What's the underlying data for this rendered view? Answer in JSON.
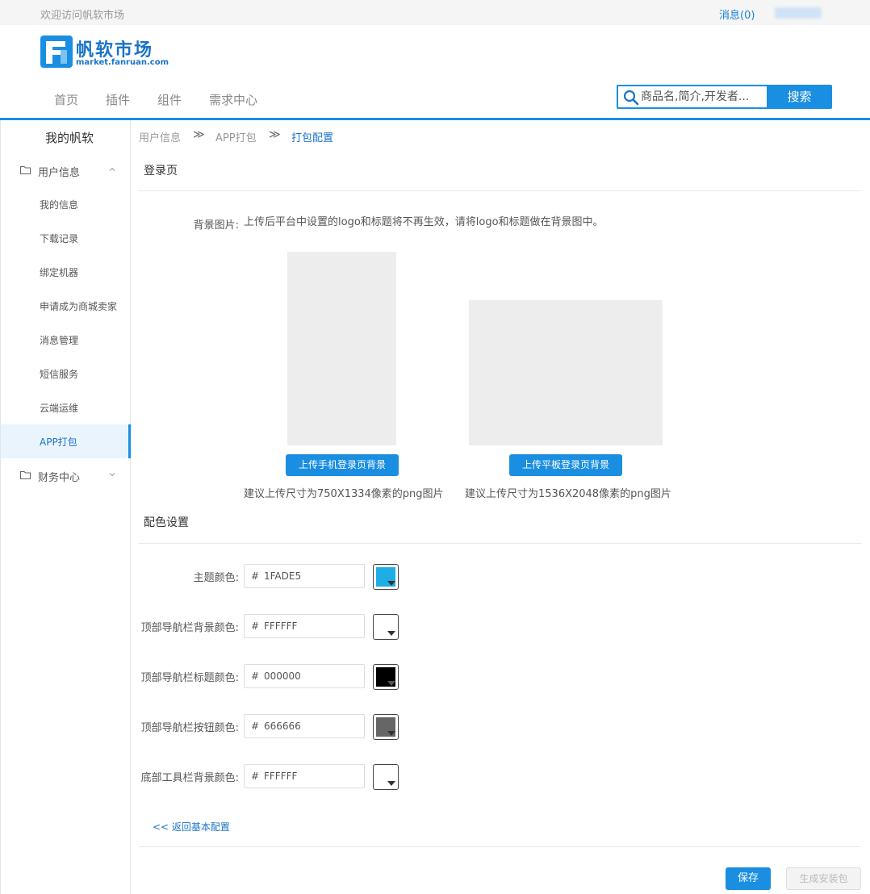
{
  "topbar": {
    "welcome": "欢迎访问帆软市场",
    "messages": "消息(0)"
  },
  "header": {
    "logo_name": "帆软市场",
    "logo_domain": "market.fanruan.com",
    "nav": [
      "首页",
      "插件",
      "组件",
      "需求中心"
    ],
    "search_placeholder": "商品名,简介,开发者...",
    "search_button": "搜索"
  },
  "sidebar": {
    "title": "我的帆软",
    "group_user": "用户信息",
    "items": [
      "我的信息",
      "下载记录",
      "绑定机器",
      "申请成为商城卖家",
      "消息管理",
      "短信服务",
      "云端运维",
      "APP打包"
    ],
    "active_item": "APP打包",
    "group_finance": "财务中心"
  },
  "breadcrumb": [
    "用户信息",
    "APP打包",
    "打包配置"
  ],
  "login_page": {
    "title": "登录页",
    "bg_label": "背景图片:",
    "bg_note": "上传后平台中设置的logo和标题将不再生效，请将logo和标题做在背景图中。",
    "phone_button": "上传手机登录页背景",
    "phone_hint": "建议上传尺寸为750X1334像素的png图片",
    "tablet_button": "上传平板登录页背景",
    "tablet_hint": "建议上传尺寸为1536X2048像素的png图片"
  },
  "color_settings": {
    "title": "配色设置",
    "hash": "#",
    "rows": [
      {
        "label": "主题颜色:",
        "value": "1FADE5",
        "color": "#1FADE5"
      },
      {
        "label": "顶部导航栏背景颜色:",
        "value": "FFFFFF",
        "color": "#FFFFFF"
      },
      {
        "label": "顶部导航栏标题颜色:",
        "value": "000000",
        "color": "#000000"
      },
      {
        "label": "顶部导航栏按钮颜色:",
        "value": "666666",
        "color": "#666666"
      },
      {
        "label": "底部工具栏背景颜色:",
        "value": "FFFFFF",
        "color": "#FFFFFF"
      }
    ]
  },
  "footer": {
    "back_link": "<<  返回基本配置",
    "save": "保存",
    "generate": "生成安装包"
  },
  "colors": {
    "primary": "#1a8ee1",
    "link": "#1a73c8",
    "active_bg": "#eaf4fc",
    "image_placeholder": "#ededed"
  }
}
